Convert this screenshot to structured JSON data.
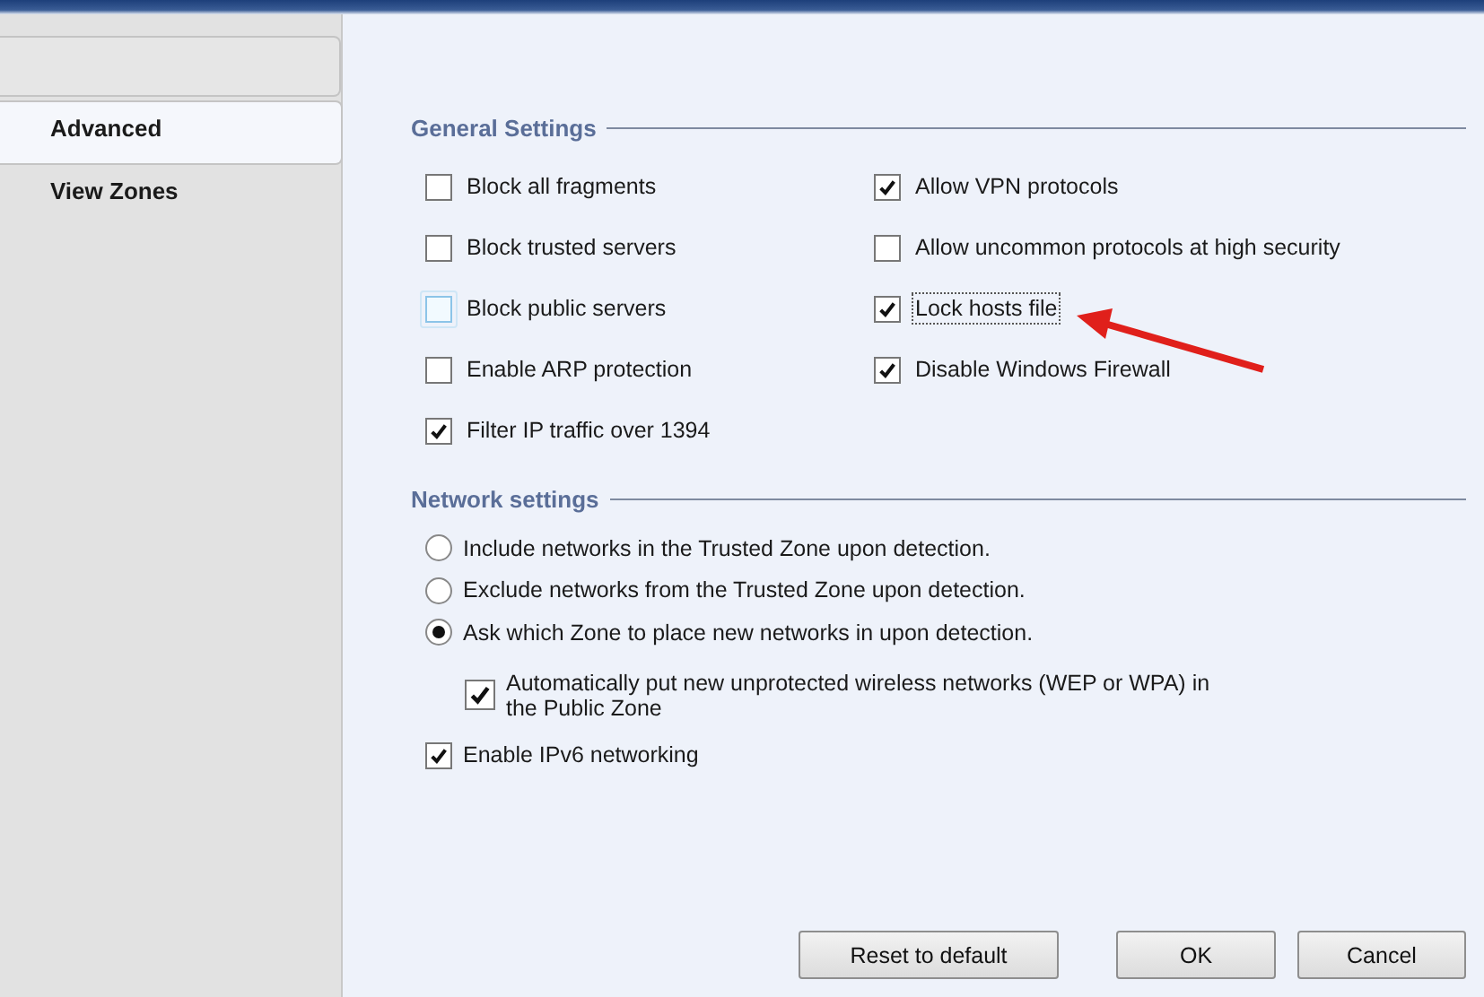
{
  "tabs": [
    {
      "label": "Advanced",
      "selected": true
    },
    {
      "label": "View Zones",
      "selected": false
    }
  ],
  "general_settings": {
    "title": "General Settings",
    "columns": [
      [
        {
          "label": "Block all fragments",
          "checked": false,
          "hovered": false,
          "focused": false
        },
        {
          "label": "Block trusted servers",
          "checked": false,
          "hovered": false,
          "focused": false
        },
        {
          "label": "Block public servers",
          "checked": false,
          "hovered": true,
          "focused": false
        },
        {
          "label": "Enable ARP protection",
          "checked": false,
          "hovered": false,
          "focused": false
        },
        {
          "label": "Filter IP traffic over 1394",
          "checked": true,
          "hovered": false,
          "focused": false
        }
      ],
      [
        {
          "label": "Allow VPN protocols",
          "checked": true,
          "hovered": false,
          "focused": false
        },
        {
          "label": "Allow uncommon protocols at high security",
          "checked": false,
          "hovered": false,
          "focused": false
        },
        {
          "label": "Lock hosts file",
          "checked": true,
          "hovered": false,
          "focused": true
        },
        {
          "label": "Disable Windows Firewall",
          "checked": true,
          "hovered": false,
          "focused": false
        }
      ]
    ]
  },
  "network_settings": {
    "title": "Network settings",
    "items": [
      {
        "kind": "radio",
        "label": "Include networks in the Trusted Zone upon detection.",
        "selected": false
      },
      {
        "kind": "radio",
        "label": "Exclude networks from the Trusted Zone upon detection.",
        "selected": false
      },
      {
        "kind": "radio",
        "label": "Ask which Zone to place new networks in upon detection.",
        "selected": true,
        "children": [
          {
            "kind": "checkbox",
            "label": "Automatically put new unprotected wireless networks (WEP or WPA) in the Public Zone",
            "checked": true
          }
        ]
      },
      {
        "kind": "checkbox",
        "label": "Enable IPv6 networking",
        "checked": true
      }
    ]
  },
  "buttons": [
    "Reset to default",
    "OK",
    "Cancel"
  ]
}
